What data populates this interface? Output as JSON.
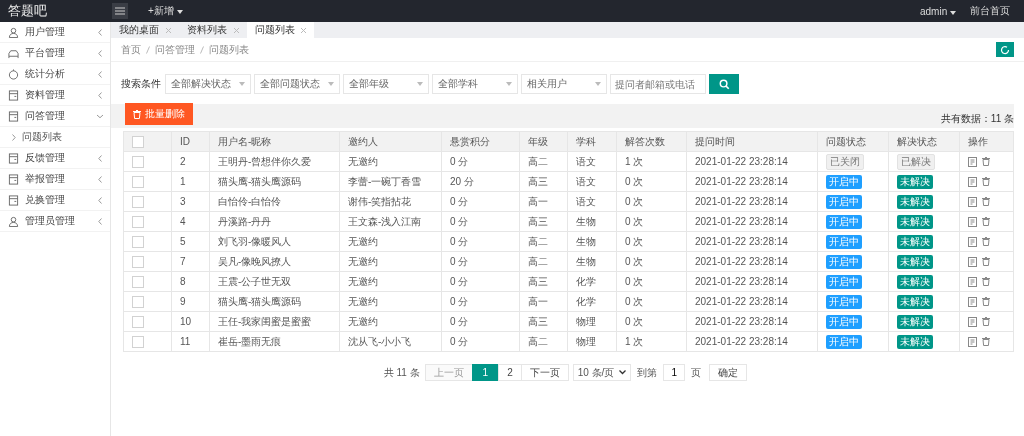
{
  "app": {
    "logo": "答题吧",
    "menu_add": "+新增",
    "user": "admin",
    "front_link": "前台首页"
  },
  "sidebar": {
    "items": [
      {
        "label": "用户管理",
        "expanded": false
      },
      {
        "label": "平台管理",
        "expanded": false
      },
      {
        "label": "统计分析",
        "expanded": false
      },
      {
        "label": "资料管理",
        "expanded": false
      },
      {
        "label": "问答管理",
        "expanded": true,
        "children": [
          {
            "label": "问题列表"
          }
        ]
      },
      {
        "label": "反馈管理",
        "expanded": false
      },
      {
        "label": "举报管理",
        "expanded": false
      },
      {
        "label": "兑换管理",
        "expanded": false
      },
      {
        "label": "管理员管理",
        "expanded": false
      }
    ]
  },
  "tabs": [
    {
      "label": "我的桌面",
      "selected": false
    },
    {
      "label": "资料列表",
      "selected": false
    },
    {
      "label": "问题列表",
      "selected": true
    }
  ],
  "breadcrumb": [
    "首页",
    "问答管理",
    "问题列表"
  ],
  "search": {
    "label": "搜索条件",
    "selects": [
      "全部解决状态",
      "全部问题状态",
      "全部年级",
      "全部学科",
      "相关用户"
    ],
    "placeholder": "提问者邮箱或电话"
  },
  "toolbar": {
    "delete_button": "批量删除",
    "total": "共有数据：11 条"
  },
  "table": {
    "all_checked": false,
    "columns": [
      "ID",
      "用户名-昵称",
      "邀约人",
      "悬赏积分",
      "年级",
      "学科",
      "解答次数",
      "提问时间",
      "问题状态",
      "解决状态",
      "操作"
    ],
    "rows": [
      {
        "checked": false,
        "cells": [
          "2",
          "王明丹-曾想伴你久爱",
          "无邀约",
          "0 分",
          "高二",
          "语文",
          "1 次",
          "2021-01-22 23:28:14"
        ],
        "question_status": {
          "text": "已关闭",
          "kind": "closed"
        },
        "solve_status": {
          "text": "已解决",
          "kind": "solved"
        }
      },
      {
        "checked": false,
        "cells": [
          "1",
          "猫头鹰-猫头鹰源码",
          "李蕾-一碗丁香雪",
          "20 分",
          "高三",
          "语文",
          "0 次",
          "2021-01-22 23:28:14"
        ],
        "question_status": {
          "text": "开启中",
          "kind": "open"
        },
        "solve_status": {
          "text": "未解决",
          "kind": "unsolved"
        }
      },
      {
        "checked": false,
        "cells": [
          "3",
          "白怡伶-白怡伶",
          "谢伟-笑指拈花",
          "0 分",
          "高一",
          "语文",
          "0 次",
          "2021-01-22 23:28:14"
        ],
        "question_status": {
          "text": "开启中",
          "kind": "open"
        },
        "solve_status": {
          "text": "未解决",
          "kind": "unsolved"
        }
      },
      {
        "checked": false,
        "cells": [
          "4",
          "丹溪路-丹丹",
          "王文森-浅入江南",
          "0 分",
          "高三",
          "生物",
          "0 次",
          "2021-01-22 23:28:14"
        ],
        "question_status": {
          "text": "开启中",
          "kind": "open"
        },
        "solve_status": {
          "text": "未解决",
          "kind": "unsolved"
        }
      },
      {
        "checked": false,
        "cells": [
          "5",
          "刘飞羽-像暖风人",
          "无邀约",
          "0 分",
          "高二",
          "生物",
          "0 次",
          "2021-01-22 23:28:14"
        ],
        "question_status": {
          "text": "开启中",
          "kind": "open"
        },
        "solve_status": {
          "text": "未解决",
          "kind": "unsolved"
        }
      },
      {
        "checked": false,
        "cells": [
          "7",
          "吴凡-像晚风撩人",
          "无邀约",
          "0 分",
          "高二",
          "生物",
          "0 次",
          "2021-01-22 23:28:14"
        ],
        "question_status": {
          "text": "开启中",
          "kind": "open"
        },
        "solve_status": {
          "text": "未解决",
          "kind": "unsolved"
        }
      },
      {
        "checked": false,
        "cells": [
          "8",
          "王震-公子世无双",
          "无邀约",
          "0 分",
          "高三",
          "化学",
          "0 次",
          "2021-01-22 23:28:14"
        ],
        "question_status": {
          "text": "开启中",
          "kind": "open"
        },
        "solve_status": {
          "text": "未解决",
          "kind": "unsolved"
        }
      },
      {
        "checked": false,
        "cells": [
          "9",
          "猫头鹰-猫头鹰源码",
          "无邀约",
          "0 分",
          "高一",
          "化学",
          "0 次",
          "2021-01-22 23:28:14"
        ],
        "question_status": {
          "text": "开启中",
          "kind": "open"
        },
        "solve_status": {
          "text": "未解决",
          "kind": "unsolved"
        }
      },
      {
        "checked": false,
        "cells": [
          "10",
          "王任-我家闺蜜是蜜蜜",
          "无邀约",
          "0 分",
          "高三",
          "物理",
          "0 次",
          "2021-01-22 23:28:14"
        ],
        "question_status": {
          "text": "开启中",
          "kind": "open"
        },
        "solve_status": {
          "text": "未解决",
          "kind": "unsolved"
        }
      },
      {
        "checked": false,
        "cells": [
          "11",
          "崔岳-墨雨无痕",
          "沈从飞-小小飞",
          "0 分",
          "高二",
          "物理",
          "1 次",
          "2021-01-22 23:28:14"
        ],
        "question_status": {
          "text": "开启中",
          "kind": "open"
        },
        "solve_status": {
          "text": "未解决",
          "kind": "unsolved"
        }
      }
    ]
  },
  "pagination": {
    "total": "共 11 条",
    "prev": {
      "label": "上一页",
      "disabled": true
    },
    "pages": [
      {
        "label": "1",
        "selected": true
      },
      {
        "label": "2",
        "selected": false
      }
    ],
    "next": "下一页",
    "page_size": "10 条/页",
    "goto": "到第",
    "page_value": "1",
    "page_unit": "页",
    "confirm": "确定"
  }
}
